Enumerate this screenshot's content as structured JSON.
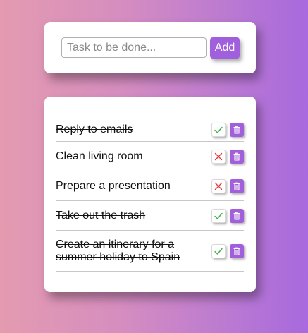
{
  "form": {
    "placeholder": "Task to be done...",
    "value": "",
    "add_label": "Add"
  },
  "tasks": [
    {
      "text": "Reply to emails",
      "done": true
    },
    {
      "text": "Clean living room",
      "done": false
    },
    {
      "text": "Prepare a presentation",
      "done": false
    },
    {
      "text": "Take out the trash",
      "done": true
    },
    {
      "text": "Create an itinerary for a summer holiday to Spain",
      "done": true
    }
  ],
  "colors": {
    "accent": "#a05fdd",
    "check": "#3cb043",
    "cross": "#e23a3a"
  },
  "icons": {
    "done": "check-icon",
    "not_done": "x-icon",
    "delete": "trash-icon"
  }
}
